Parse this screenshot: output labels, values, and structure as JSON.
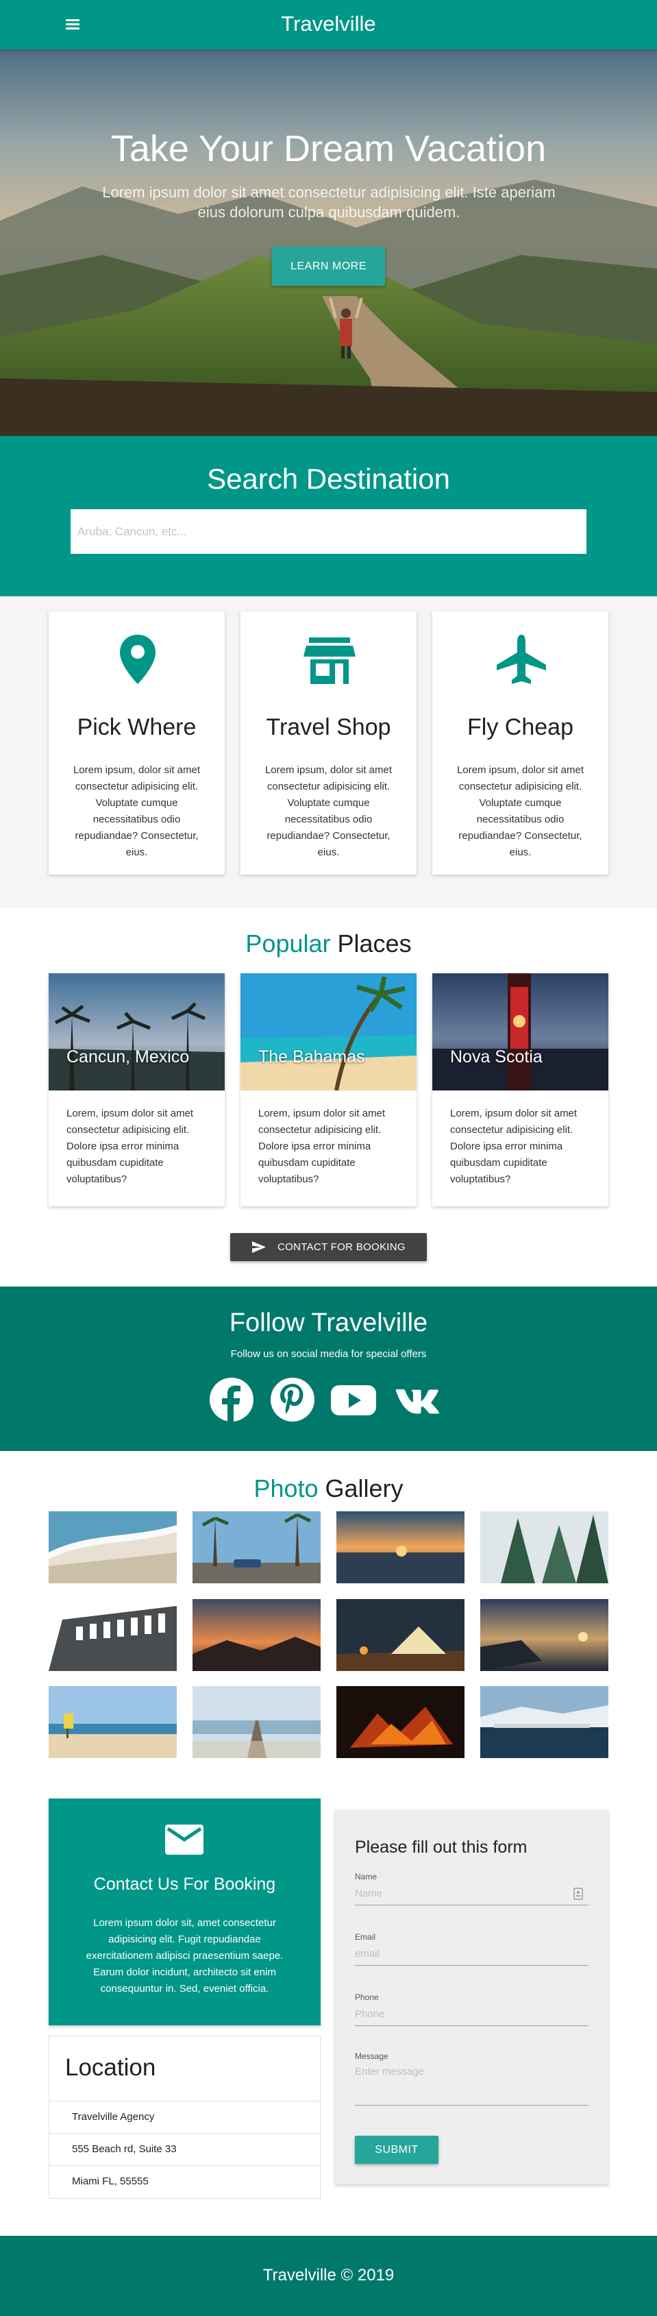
{
  "nav": {
    "brand": "Travelville",
    "menu_icon": "hamburger-menu-icon"
  },
  "hero": {
    "title": "Take Your Dream Vacation",
    "subtitle": "Lorem ipsum dolor sit amet consectetur adipisicing elit. Iste aperiam eius dolorum culpa quibusdam quidem.",
    "button": "LEARN MORE"
  },
  "search": {
    "title": "Search Destination",
    "placeholder": "Aruba, Cancun, etc..."
  },
  "features": [
    {
      "icon": "map-pin-icon",
      "title": "Pick Where",
      "text": "Lorem ipsum, dolor sit amet consectetur adipisicing elit. Voluptate cumque necessitatibus odio repudiandae? Consectetur, eius."
    },
    {
      "icon": "store-icon",
      "title": "Travel Shop",
      "text": "Lorem ipsum, dolor sit amet consectetur adipisicing elit. Voluptate cumque necessitatibus odio repudiandae? Consectetur, eius."
    },
    {
      "icon": "airplane-icon",
      "title": "Fly Cheap",
      "text": "Lorem ipsum, dolor sit amet consectetur adipisicing elit. Voluptate cumque necessitatibus odio repudiandae? Consectetur, eius."
    }
  ],
  "popular": {
    "title_highlight": "Popular",
    "title_rest": " Places",
    "places": [
      {
        "name": "Cancun, Mexico",
        "text": "Lorem, ipsum dolor sit amet consectetur adipisicing elit. Dolore ipsa error minima quibusdam cupiditate voluptatibus?"
      },
      {
        "name": "The Bahamas",
        "text": "Lorem, ipsum dolor sit amet consectetur adipisicing elit. Dolore ipsa error minima quibusdam cupiditate voluptatibus?"
      },
      {
        "name": "Nova Scotia",
        "text": "Lorem, ipsum dolor sit amet consectetur adipisicing elit. Dolore ipsa error minima quibusdam cupiditate voluptatibus?"
      }
    ],
    "button": "CONTACT FOR BOOKING"
  },
  "follow": {
    "title": "Follow Travelville",
    "subtitle": "Follow us on social media for special offers",
    "icons": [
      "facebook-icon",
      "pinterest-icon",
      "youtube-icon",
      "vk-icon"
    ]
  },
  "gallery": {
    "title_highlight": "Photo",
    "title_rest": " Gallery"
  },
  "contact": {
    "title": "Contact Us For Booking",
    "text": "Lorem ipsum dolor sit, amet consectetur adipisicing elit. Fugit repudiandae exercitationem adipisci praesentium saepe. Earum dolor incidunt, architecto sit enim consequuntur in. Sed, eveniet officia."
  },
  "location": {
    "title": "Location",
    "lines": [
      "Travelville Agency",
      "555 Beach rd, Suite 33",
      "Miami FL, 55555"
    ]
  },
  "form": {
    "title": "Please fill out this form",
    "name_label": "Name",
    "name_placeholder": "Name",
    "email_label": "Email",
    "email_placeholder": "email",
    "phone_label": "Phone",
    "phone_placeholder": "Phone",
    "message_label": "Message",
    "message_placeholder": "Enter message",
    "submit": "SUBMIT"
  },
  "footer": {
    "text": "Travelville © 2019"
  },
  "colors": {
    "primary": "#009688",
    "primary_dark": "#00796b",
    "accent": "#26a69a",
    "dark_button": "#424242"
  }
}
